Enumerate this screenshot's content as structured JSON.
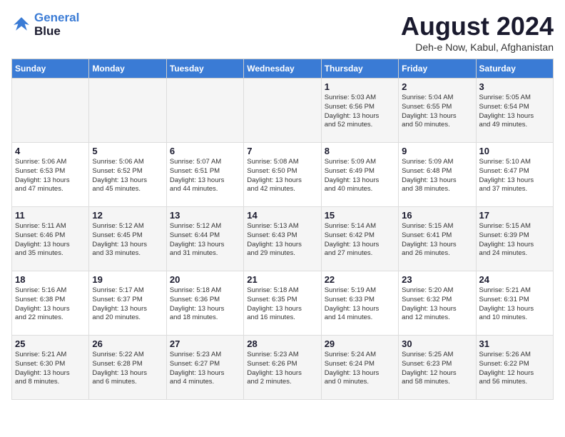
{
  "logo": {
    "line1": "General",
    "line2": "Blue"
  },
  "title": "August 2024",
  "subtitle": "Deh-e Now, Kabul, Afghanistan",
  "days_of_week": [
    "Sunday",
    "Monday",
    "Tuesday",
    "Wednesday",
    "Thursday",
    "Friday",
    "Saturday"
  ],
  "weeks": [
    [
      {
        "day": "",
        "info": ""
      },
      {
        "day": "",
        "info": ""
      },
      {
        "day": "",
        "info": ""
      },
      {
        "day": "",
        "info": ""
      },
      {
        "day": "1",
        "info": "Sunrise: 5:03 AM\nSunset: 6:56 PM\nDaylight: 13 hours\nand 52 minutes."
      },
      {
        "day": "2",
        "info": "Sunrise: 5:04 AM\nSunset: 6:55 PM\nDaylight: 13 hours\nand 50 minutes."
      },
      {
        "day": "3",
        "info": "Sunrise: 5:05 AM\nSunset: 6:54 PM\nDaylight: 13 hours\nand 49 minutes."
      }
    ],
    [
      {
        "day": "4",
        "info": "Sunrise: 5:06 AM\nSunset: 6:53 PM\nDaylight: 13 hours\nand 47 minutes."
      },
      {
        "day": "5",
        "info": "Sunrise: 5:06 AM\nSunset: 6:52 PM\nDaylight: 13 hours\nand 45 minutes."
      },
      {
        "day": "6",
        "info": "Sunrise: 5:07 AM\nSunset: 6:51 PM\nDaylight: 13 hours\nand 44 minutes."
      },
      {
        "day": "7",
        "info": "Sunrise: 5:08 AM\nSunset: 6:50 PM\nDaylight: 13 hours\nand 42 minutes."
      },
      {
        "day": "8",
        "info": "Sunrise: 5:09 AM\nSunset: 6:49 PM\nDaylight: 13 hours\nand 40 minutes."
      },
      {
        "day": "9",
        "info": "Sunrise: 5:09 AM\nSunset: 6:48 PM\nDaylight: 13 hours\nand 38 minutes."
      },
      {
        "day": "10",
        "info": "Sunrise: 5:10 AM\nSunset: 6:47 PM\nDaylight: 13 hours\nand 37 minutes."
      }
    ],
    [
      {
        "day": "11",
        "info": "Sunrise: 5:11 AM\nSunset: 6:46 PM\nDaylight: 13 hours\nand 35 minutes."
      },
      {
        "day": "12",
        "info": "Sunrise: 5:12 AM\nSunset: 6:45 PM\nDaylight: 13 hours\nand 33 minutes."
      },
      {
        "day": "13",
        "info": "Sunrise: 5:12 AM\nSunset: 6:44 PM\nDaylight: 13 hours\nand 31 minutes."
      },
      {
        "day": "14",
        "info": "Sunrise: 5:13 AM\nSunset: 6:43 PM\nDaylight: 13 hours\nand 29 minutes."
      },
      {
        "day": "15",
        "info": "Sunrise: 5:14 AM\nSunset: 6:42 PM\nDaylight: 13 hours\nand 27 minutes."
      },
      {
        "day": "16",
        "info": "Sunrise: 5:15 AM\nSunset: 6:41 PM\nDaylight: 13 hours\nand 26 minutes."
      },
      {
        "day": "17",
        "info": "Sunrise: 5:15 AM\nSunset: 6:39 PM\nDaylight: 13 hours\nand 24 minutes."
      }
    ],
    [
      {
        "day": "18",
        "info": "Sunrise: 5:16 AM\nSunset: 6:38 PM\nDaylight: 13 hours\nand 22 minutes."
      },
      {
        "day": "19",
        "info": "Sunrise: 5:17 AM\nSunset: 6:37 PM\nDaylight: 13 hours\nand 20 minutes."
      },
      {
        "day": "20",
        "info": "Sunrise: 5:18 AM\nSunset: 6:36 PM\nDaylight: 13 hours\nand 18 minutes."
      },
      {
        "day": "21",
        "info": "Sunrise: 5:18 AM\nSunset: 6:35 PM\nDaylight: 13 hours\nand 16 minutes."
      },
      {
        "day": "22",
        "info": "Sunrise: 5:19 AM\nSunset: 6:33 PM\nDaylight: 13 hours\nand 14 minutes."
      },
      {
        "day": "23",
        "info": "Sunrise: 5:20 AM\nSunset: 6:32 PM\nDaylight: 13 hours\nand 12 minutes."
      },
      {
        "day": "24",
        "info": "Sunrise: 5:21 AM\nSunset: 6:31 PM\nDaylight: 13 hours\nand 10 minutes."
      }
    ],
    [
      {
        "day": "25",
        "info": "Sunrise: 5:21 AM\nSunset: 6:30 PM\nDaylight: 13 hours\nand 8 minutes."
      },
      {
        "day": "26",
        "info": "Sunrise: 5:22 AM\nSunset: 6:28 PM\nDaylight: 13 hours\nand 6 minutes."
      },
      {
        "day": "27",
        "info": "Sunrise: 5:23 AM\nSunset: 6:27 PM\nDaylight: 13 hours\nand 4 minutes."
      },
      {
        "day": "28",
        "info": "Sunrise: 5:23 AM\nSunset: 6:26 PM\nDaylight: 13 hours\nand 2 minutes."
      },
      {
        "day": "29",
        "info": "Sunrise: 5:24 AM\nSunset: 6:24 PM\nDaylight: 13 hours\nand 0 minutes."
      },
      {
        "day": "30",
        "info": "Sunrise: 5:25 AM\nSunset: 6:23 PM\nDaylight: 12 hours\nand 58 minutes."
      },
      {
        "day": "31",
        "info": "Sunrise: 5:26 AM\nSunset: 6:22 PM\nDaylight: 12 hours\nand 56 minutes."
      }
    ]
  ]
}
